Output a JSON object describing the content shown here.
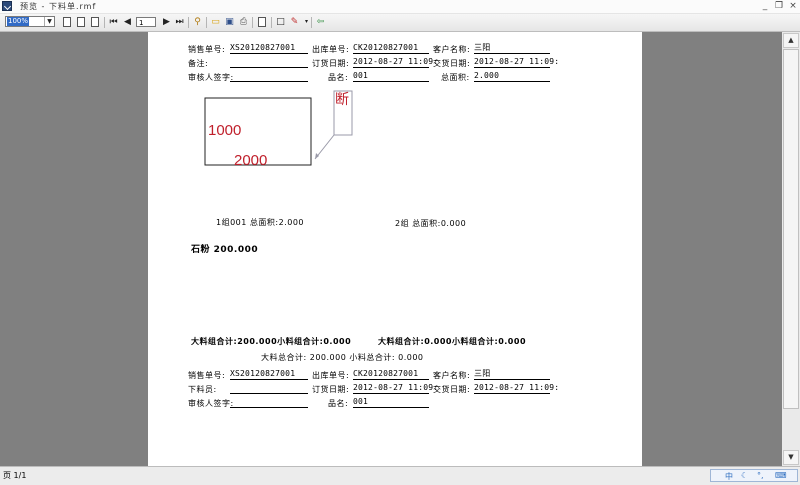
{
  "window": {
    "title": "预览 - 下料单.rmf",
    "buttons": {
      "minimize": "_",
      "restore": "❐",
      "close": "×"
    }
  },
  "toolbar": {
    "zoom": "100%",
    "page_number": "1",
    "icons": [
      "single-page-icon",
      "two-page-icon",
      "multi-page-icon",
      "first-page-icon",
      "prev-page-icon",
      "next-page-icon",
      "last-page-icon",
      "zoom-icon",
      "open-icon",
      "save-icon",
      "print-icon",
      "page-setup-icon",
      "border-icon",
      "pen-icon",
      "exit-icon"
    ]
  },
  "report": {
    "header1": {
      "sales_no_label": "销售单号:",
      "sales_no": "XS20120827001",
      "out_no_label": "出库单号:",
      "out_no": "CK20120827001",
      "customer_label": "客户名称:",
      "customer": "三阳",
      "remark_label": "备注:",
      "remark": "",
      "order_date_label": "订货日期:",
      "order_date": "2012-08-27 11:09:",
      "delivery_date_label": "交货日期:",
      "delivery_date": "2012-08-27 11:09:",
      "reviewer_label": "审核人签字:",
      "reviewer": "",
      "product_label": "品名:",
      "product": "001",
      "total_area_label": "总面积:",
      "total_area": "2.000"
    },
    "drawing": {
      "width_value": "1000",
      "height_value": "2000",
      "callout_char": "断"
    },
    "group1": "1组001 总面积:2.000",
    "group2": "2组 总面积:0.000",
    "stone": "石粉 200.000",
    "summary": {
      "left": "大料组合计:200.000小料组合计:0.000",
      "right": "大料组合计:0.000小料组合计:0.000",
      "total": "大料总合计: 200.000 小料总合计: 0.000"
    },
    "header2": {
      "sales_no_label": "销售单号:",
      "sales_no": "XS20120827001",
      "out_no_label": "出库单号:",
      "out_no": "CK20120827001",
      "customer_label": "客户名称:",
      "customer": "三阳",
      "cutter_label": "下料员:",
      "cutter": "",
      "order_date_label": "订货日期:",
      "order_date": "2012-08-27 11:09:",
      "delivery_date_label": "交货日期:",
      "delivery_date": "2012-08-27 11:09:",
      "reviewer_label": "审核人签字:",
      "reviewer": "",
      "product_label": "品名:",
      "product": "001"
    }
  },
  "status": {
    "page_info": "页 1/1",
    "ime": [
      "中",
      "☾",
      "°,",
      "⌨"
    ]
  },
  "colors": {
    "drawing_text": "#c0202c",
    "callout_line": "#9a9aa8",
    "background": "#808080"
  }
}
